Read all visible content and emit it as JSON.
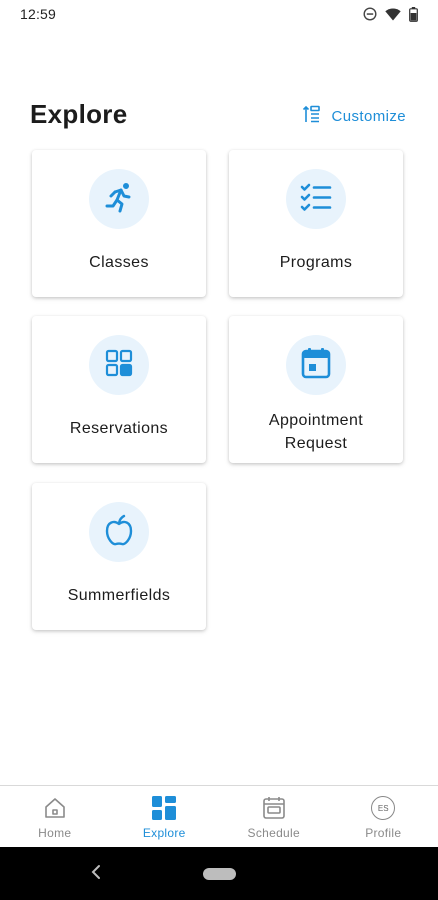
{
  "status_bar": {
    "time": "12:59"
  },
  "header": {
    "title": "Explore",
    "customize_label": "Customize"
  },
  "tiles": [
    {
      "label": "Classes",
      "icon": "runner-icon"
    },
    {
      "label": "Programs",
      "icon": "checklist-icon"
    },
    {
      "label": "Reservations",
      "icon": "grid-icon"
    },
    {
      "label_line1": "Appointment",
      "label_line2": "Request",
      "icon": "calendar-icon"
    },
    {
      "label": "Summerfields",
      "icon": "apple-icon"
    }
  ],
  "bottom_nav": {
    "items": [
      {
        "label": "Home",
        "icon": "home-icon"
      },
      {
        "label": "Explore",
        "icon": "explore-icon",
        "active": true
      },
      {
        "label": "Schedule",
        "icon": "schedule-icon"
      },
      {
        "label": "Profile",
        "icon": "profile-avatar",
        "avatar_initials": "ES"
      }
    ]
  },
  "colors": {
    "accent": "#1e8ed8",
    "icon_bg": "#e8f3fc",
    "inactive": "#8a8a8a"
  }
}
